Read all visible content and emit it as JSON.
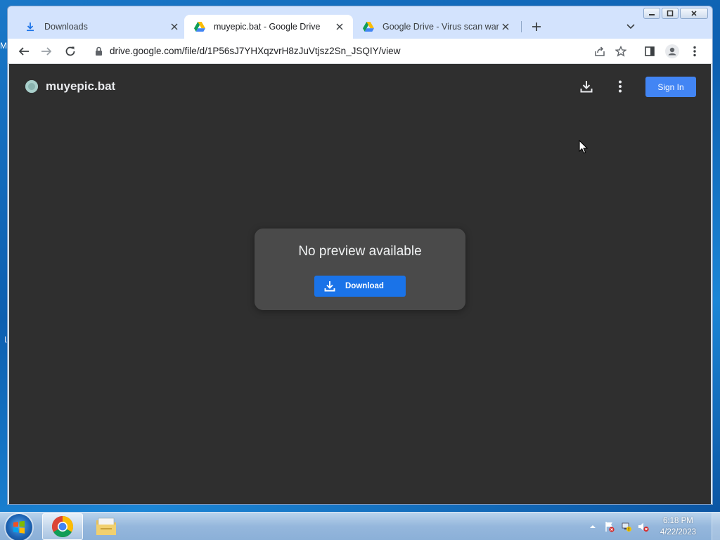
{
  "browser": {
    "tabs": [
      {
        "title": "Downloads",
        "icon": "download-icon",
        "active": false
      },
      {
        "title": "muyepic.bat - Google Drive",
        "icon": "google-drive-icon",
        "active": true
      },
      {
        "title": "Google Drive - Virus scan warnin",
        "icon": "google-drive-icon",
        "active": false
      }
    ],
    "url": "drive.google.com/file/d/1P56sJ7YHXqzvrH8zJuVtjsz2Sn_JSQIY/view"
  },
  "viewer": {
    "filename": "muyepic.bat",
    "signin_label": "Sign In",
    "no_preview_text": "No preview available",
    "download_label": "Download"
  },
  "taskbar": {
    "time": "6:18 PM",
    "date": "4/22/2023"
  },
  "desktop": {
    "edge_glyph": "M",
    "edge_glyph2": "L"
  },
  "colors": {
    "viewer_bg": "#2f2f2f",
    "accent": "#1a73e8",
    "signin": "#4285f4",
    "tabstrip": "#d3e3fd"
  }
}
